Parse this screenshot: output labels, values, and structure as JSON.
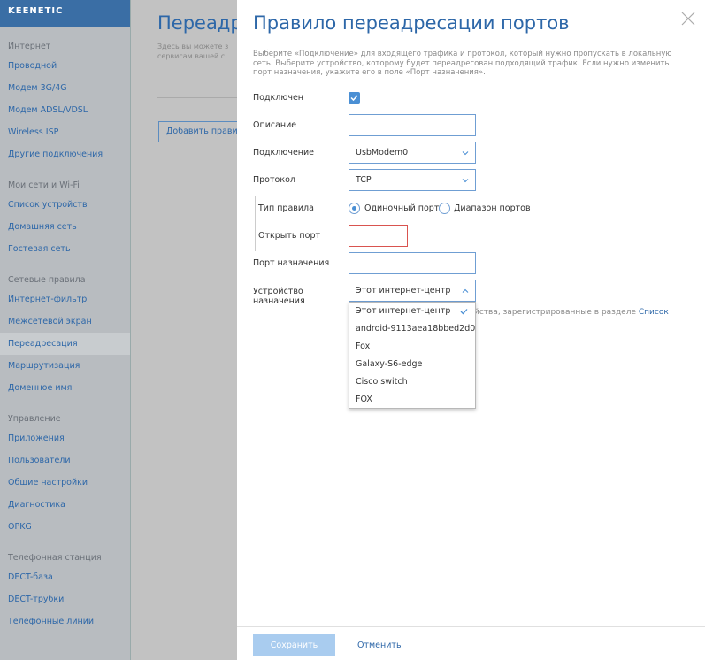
{
  "logo": "KEENETIC",
  "sidebar": {
    "groups": [
      {
        "head": "Интернет",
        "items": [
          "Проводной",
          "Модем 3G/4G",
          "Модем ADSL/VDSL",
          "Wireless ISP",
          "Другие подключения"
        ]
      },
      {
        "head": "Мои сети и Wi-Fi",
        "items": [
          "Список устройств",
          "Домашняя сеть",
          "Гостевая сеть"
        ]
      },
      {
        "head": "Сетевые правила",
        "items": [
          "Интернет-фильтр",
          "Межсетевой экран",
          "Переадресация",
          "Маршрутизация",
          "Доменное имя"
        ]
      },
      {
        "head": "Управление",
        "items": [
          "Приложения",
          "Пользователи",
          "Общие настройки",
          "Диагностика",
          "OPKG"
        ]
      },
      {
        "head": "Телефонная станция",
        "items": [
          "DECT-база",
          "DECT-трубки",
          "Телефонные линии"
        ]
      }
    ],
    "active": "Переадресация"
  },
  "background": {
    "title": "Переадр",
    "desc_line1": "Здесь вы можете з",
    "desc_line2": "сервисам вашей с",
    "add_button": "Добавить прави"
  },
  "modal": {
    "title": "Правило переадресации портов",
    "description": "Выберите «Подключение» для входящего трафика и протокол, который нужно пропускать в локальную сеть. Выберите устройство, которому будет переадресован подходящий трафик. Если нужно изменить порт назначения, укажите его в поле «Порт назначения».",
    "enabled_label": "Подключен",
    "description_label": "Описание",
    "description_value": "",
    "connection_label": "Подключение",
    "connection_value": "UsbModem0",
    "protocol_label": "Протокол",
    "protocol_value": "TCP",
    "rule_type_label": "Тип правила",
    "rule_type_single": "Одиночный порт",
    "rule_type_range": "Диапазон портов",
    "open_port_label": "Открыть порт",
    "open_port_value": "",
    "dest_port_label": "Порт назначения",
    "dest_port_value": "",
    "dest_device_label_1": "Устройство",
    "dest_device_label_2": "назначения",
    "dest_device_value": "Этот интернет-центр",
    "hint_text": "йства, зарегистрированные в разделе ",
    "hint_link": "Список",
    "dropdown_options": [
      "Этот интернет-центр",
      "android-9113aea18bbed2d0",
      "Fox",
      "Galaxy-S6-edge",
      "Cisco switch",
      "FOX"
    ],
    "save_label": "Сохранить",
    "cancel_label": "Отменить"
  },
  "colors": {
    "accent": "#2d67a8",
    "checkbox": "#4a8fd4",
    "error": "#d9534f"
  }
}
